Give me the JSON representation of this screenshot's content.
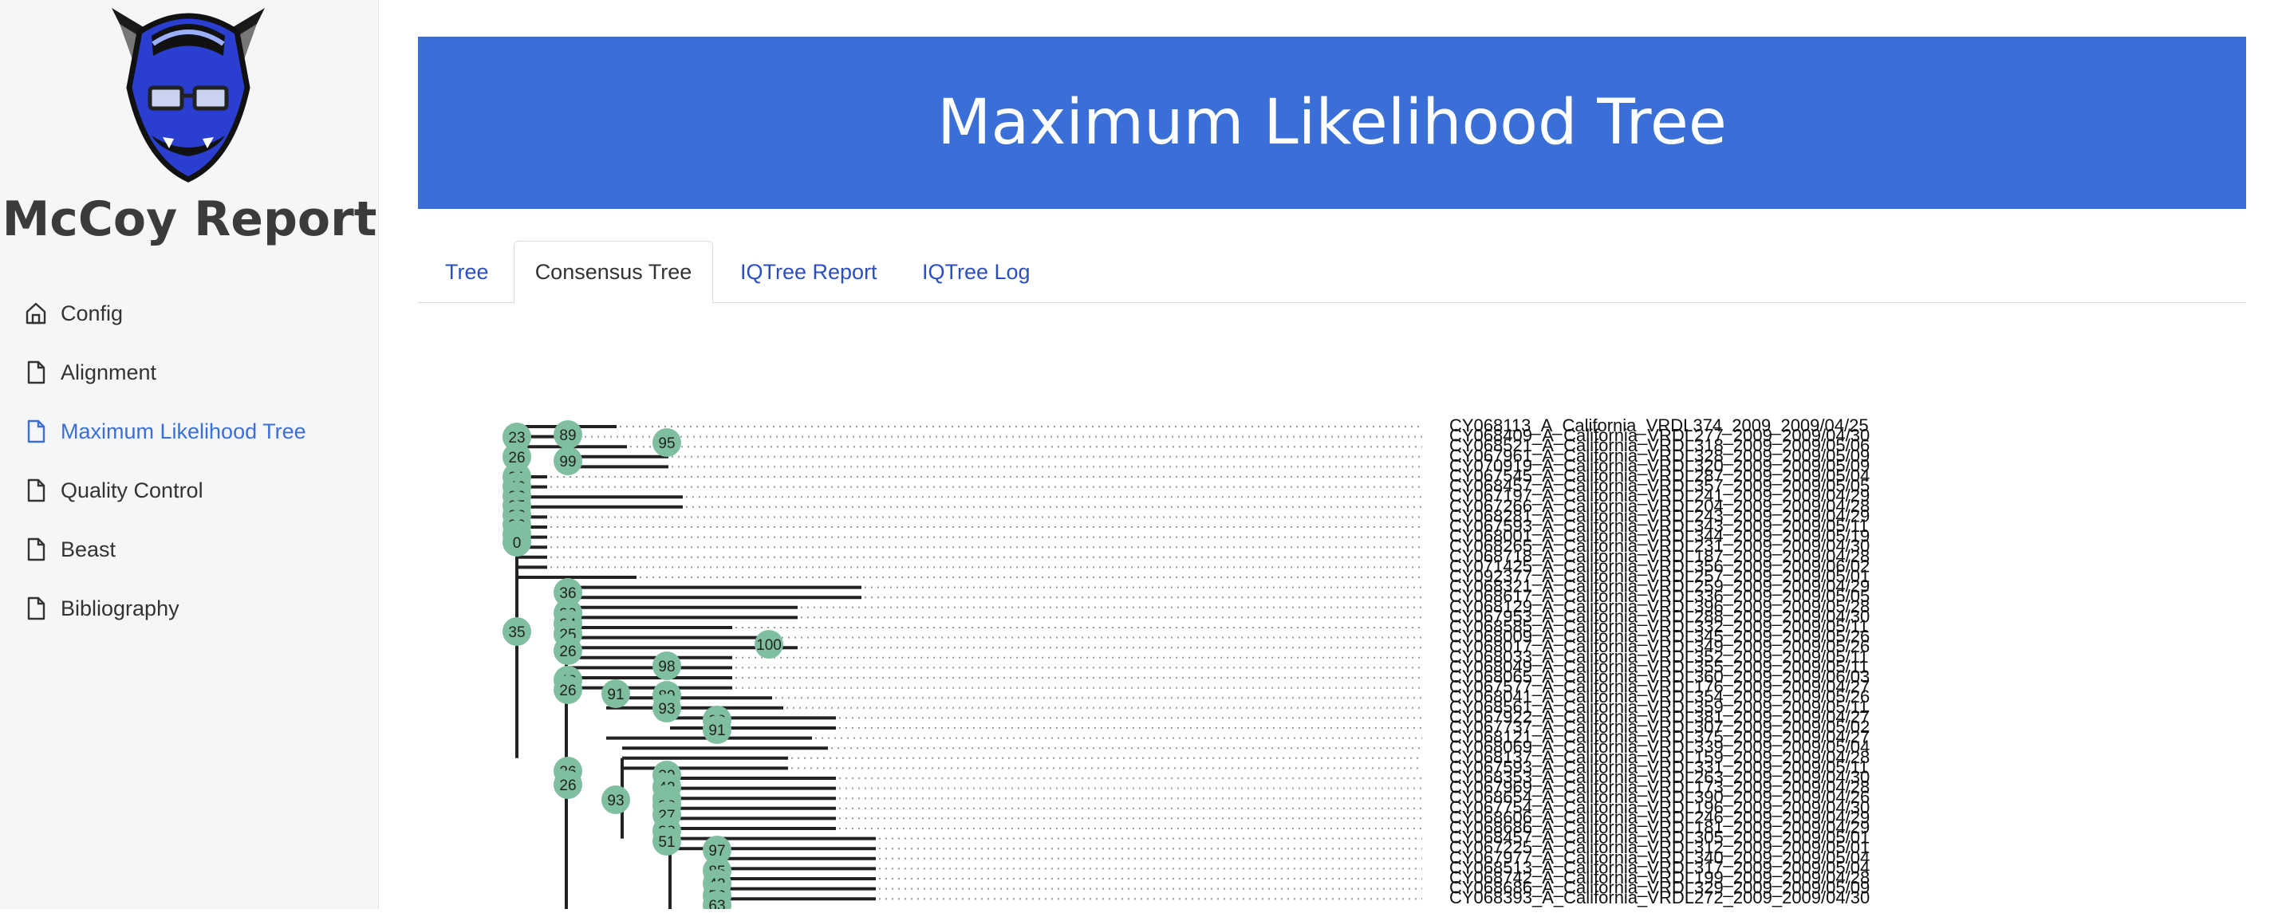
{
  "sidebar": {
    "brand": "McCoy Report",
    "items": [
      {
        "label": "Config",
        "icon": "home-icon",
        "active": false
      },
      {
        "label": "Alignment",
        "icon": "file-icon",
        "active": false
      },
      {
        "label": "Maximum Likelihood Tree",
        "icon": "file-icon",
        "active": true
      },
      {
        "label": "Quality Control",
        "icon": "file-icon",
        "active": false
      },
      {
        "label": "Beast",
        "icon": "file-icon",
        "active": false
      },
      {
        "label": "Bibliography",
        "icon": "file-icon",
        "active": false
      }
    ]
  },
  "header": {
    "title": "Maximum Likelihood Tree"
  },
  "tabs": [
    {
      "label": "Tree",
      "active": false
    },
    {
      "label": "Consensus Tree",
      "active": true
    },
    {
      "label": "IQTree Report",
      "active": false
    },
    {
      "label": "IQTree Log",
      "active": false
    }
  ],
  "colors": {
    "accent": "#3a6fd8",
    "link": "#2a4fc0",
    "node": "#7fbf9f",
    "active_nav": "#3a6ed8"
  },
  "tree": {
    "tips": [
      "CY068113_A_California_VRDL374_2009_2009/04/25",
      "CY068409_A_California_VRDL277_2009_2009/04/30",
      "CY068521_A_California_VRDL318_2009_2009/05/06",
      "CY067961_A_California_VRDL328_2009_2009/05/09",
      "CY070919_A_California_VRDL320_2009_2009/05/09",
      "CY067545_A_California_VRDL287_2009_2009/05/04",
      "CY068457_A_California_VRDL357_2009_2009/05/05",
      "CY067197_A_California_VRDL241_2009_2009/04/29",
      "CY067266_A_California_VRDL204_2009_2009/04/28",
      "CY068281_A_California_VRDL243_2009_2009/04/29",
      "CY067593_A_California_VRDL343_2009_2009/05/11",
      "CY068001_A_California_VRDL344_2009_2009/05/19",
      "CY068265_A_California_VRDL231_2009_2009/04/30",
      "CY068718_A_California_VRDL187_2009_2009/04/28",
      "CY071425_A_California_VRDL356_2009_2009/06/02",
      "CY092377_A_California_VRDL257_2009_2009/05/01",
      "CY068321_A_California_VRDL259_2009_2009/04/29",
      "CY068617_A_California_VRDL336_2009_2009/05/05",
      "CY068129_A_California_VRDL396_2009_2009/05/28",
      "CY067953_A_California_VRDL288_2009_2009/04/30",
      "CY068585_A_California_VRDL332_2009_2009/05/11",
      "CY068009_A_California_VRDL345_2009_2009/05/26",
      "CY068017_A_California_VRDL349_2009_2009/05/26",
      "CY068033_A_California_VRDL352_2009_2009/05/11",
      "CY068049_A_California_VRDL355_2009_2009/05/11",
      "CY068065_A_California_VRDL360_2009_2009/06/03",
      "CY067577_A_California_VRDL176_2009_2009/04/27",
      "CY068041_A_California_VRDL354_2009_2009/05/26",
      "CY068561_A_California_VRDL359_2009_2009/05/11",
      "CY067922_A_California_VRDL381_2009_2009/04/27",
      "CY067737_A_California_VRDL307_2009_2009/05/02",
      "CY068121_A_California_VRDL375_2009_2009/04/27",
      "CY068069_A_California_VRDL339_2009_2009/05/04",
      "CY068137_A_California_VRDL159_2009_2009/04/28",
      "CY067593_A_California_VRDL331_2009_2009/05/11",
      "CY068353_A_California_VRDL263_2009_2009/04/30",
      "CY067969_A_California_VRDL173_2009_2009/04/28",
      "CY068654_A_California_VRDL390_2009_2009/04/26",
      "CY067754_A_California_VRDL196_2009_2009/04/30",
      "CY068606_A_California_VRDL246_2009_2009/04/29",
      "CY068686_A_California_VRDL181_2009_2009/04/29",
      "CY068457_A_California_VRDL305_2009_2009/05/01",
      "CY067225_A_California_VRDL312_2009_2009/05/01",
      "CY067977_A_California_VRDL340_2009_2009/05/04",
      "CY068513_A_California_VRDL317_2009_2009/05/04",
      "CY068742_A_California_VRDL199_2009_2009/04/28",
      "CY068686_A_California_VRDL329_2009_2009/05/09",
      "CY068393_A_California_VRDL272_2009_2009/04/30"
    ],
    "support": [
      23,
      26,
      21,
      40,
      20,
      25,
      23,
      32,
      44,
      0,
      89,
      99,
      95,
      35,
      36,
      32,
      24,
      25,
      26,
      100,
      98,
      43,
      26,
      91,
      89,
      93,
      98,
      91,
      26,
      26,
      93,
      39,
      42,
      35,
      38,
      27,
      38,
      51,
      97,
      85,
      42,
      56,
      63
    ]
  }
}
